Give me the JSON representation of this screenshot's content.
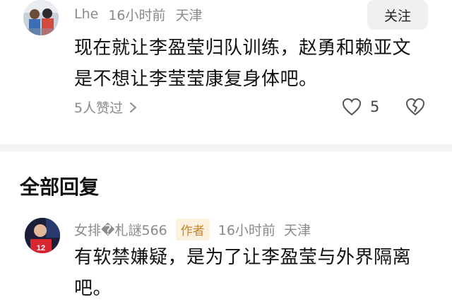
{
  "comment": {
    "username": "Lhe",
    "time": "16小时前",
    "location": "天津",
    "follow_label": "关注",
    "text": "现在就让李盈莹归队训练，赵勇和赖亚文是不想让李莹莹康复身体吧。",
    "likes_text": "5人赞过",
    "like_count": "5"
  },
  "replies_section": {
    "title": "全部回复"
  },
  "reply": {
    "username": "女排�札謎566",
    "author_badge": "作者",
    "time": "16小时前",
    "location": "天津",
    "text": "有软禁嫌疑，是为了让李盈莹与外界隔离吧。",
    "jersey_number": "12"
  },
  "colors": {
    "meta_gray": "#8a8a8a",
    "author_badge_bg": "#fbf1de",
    "author_badge_text": "#c8822d",
    "follow_bg": "#f0f0f0",
    "divider": "#f4f4f4"
  },
  "icons": [
    "chevron-right-icon",
    "heart-icon",
    "broken-heart-icon"
  ]
}
